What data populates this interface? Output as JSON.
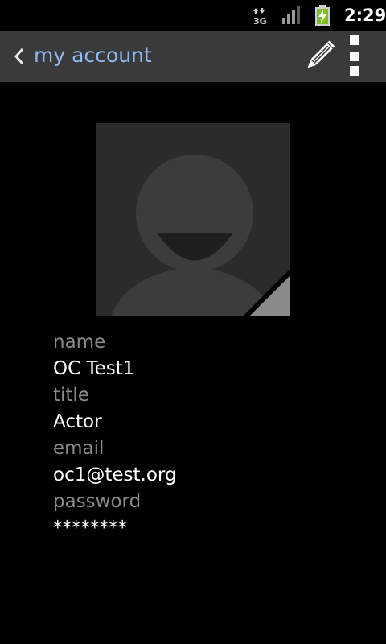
{
  "status_bar": {
    "network_type": "3G",
    "time": "2:29",
    "icons": [
      "data-transfer-icon",
      "signal-strength-icon",
      "battery-charging-icon"
    ]
  },
  "action_bar": {
    "title": "my account",
    "icons": [
      "back-chevron-icon",
      "pencil-edit-icon",
      "overflow-menu-icon"
    ],
    "title_color": "#8fb8ef",
    "background": "#3a3a3a"
  },
  "avatar": {
    "icon": "default-person-icon"
  },
  "fields": [
    {
      "label": "name",
      "value": "OC Test1"
    },
    {
      "label": "title",
      "value": "Actor"
    },
    {
      "label": "email",
      "value": "oc1@test.org"
    },
    {
      "label": "password",
      "value": "********"
    }
  ],
  "colors": {
    "label": "#8a8a8a",
    "value": "#ffffff",
    "background": "#000000"
  }
}
